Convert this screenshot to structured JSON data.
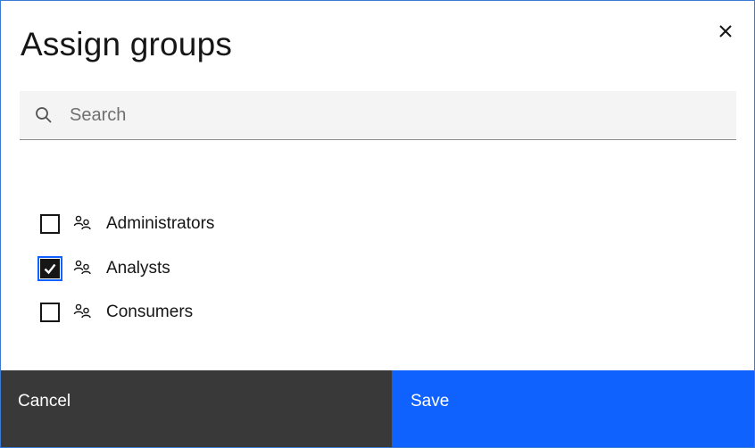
{
  "dialog": {
    "title": "Assign groups",
    "close_icon": "close-icon"
  },
  "search": {
    "placeholder": "Search",
    "value": "",
    "icon": "search-icon"
  },
  "groups": [
    {
      "label": "Administrators",
      "checked": false,
      "icon": "user-group-icon"
    },
    {
      "label": "Analysts",
      "checked": true,
      "icon": "user-group-icon"
    },
    {
      "label": "Consumers",
      "checked": false,
      "icon": "user-group-icon"
    }
  ],
  "footer": {
    "cancel_label": "Cancel",
    "save_label": "Save"
  },
  "colors": {
    "primary": "#0f62fe",
    "secondary": "#393939",
    "text": "#161616"
  }
}
